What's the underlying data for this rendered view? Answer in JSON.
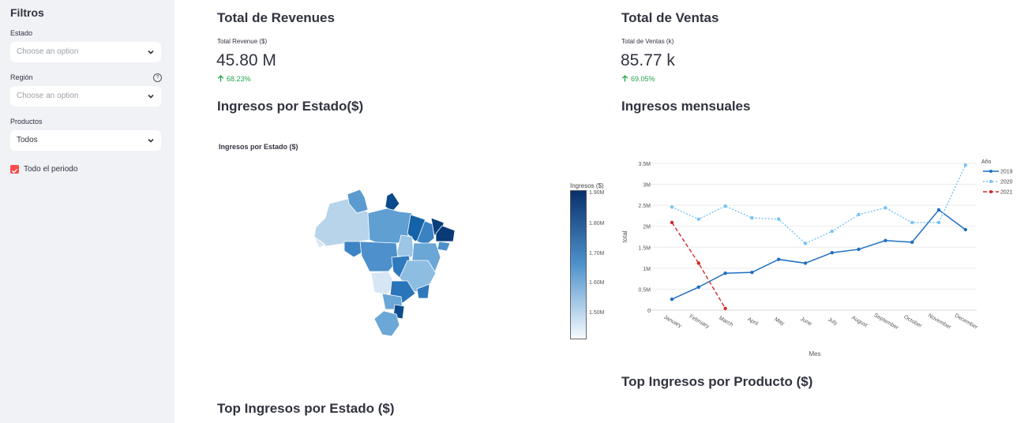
{
  "sidebar": {
    "title": "Filtros",
    "estado": {
      "label": "Estado",
      "placeholder": "Choose an option"
    },
    "region": {
      "label": "Región",
      "placeholder": "Choose an option",
      "help": "?"
    },
    "productos": {
      "label": "Productos",
      "value": "Todos"
    },
    "periodo": {
      "label": "Todo el periodo",
      "checked": true
    }
  },
  "revenues": {
    "heading": "Total de Revenues",
    "metric_label": "Total Revenue ($)",
    "metric_value": "45.80 M",
    "delta": "68.23%"
  },
  "ventas": {
    "heading": "Total de Ventas",
    "metric_label": "Total de Ventas (k)",
    "metric_value": "85.77 k",
    "delta": "69.05%"
  },
  "map_section": {
    "heading": "Ingresos por Estado($)",
    "chart_title": "Ingresos por Estado ($)",
    "colorbar_title": "Ingresos ($)",
    "colorbar_ticks": [
      "1.90M",
      "1.80M",
      "1.70M",
      "1.60M",
      "1.50M"
    ]
  },
  "line_section": {
    "heading": "Ingresos mensuales"
  },
  "top_producto": {
    "heading": "Top Ingresos por Producto ($)"
  },
  "top_estado": {
    "heading": "Top Ingresos por Estado ($)"
  },
  "colors": {
    "accent": "#ff4b4b",
    "delta": "#21a348",
    "s2019": "#1f6fc2",
    "s2020": "#79c3f2",
    "s2021": "#d62728"
  },
  "chart_data": {
    "type": "line",
    "xlabel": "Mes",
    "ylabel": "total",
    "legend_title": "Año",
    "legend_position": "top-right",
    "ylim": [
      0,
      3500000
    ],
    "yticks": [
      0,
      500000,
      1000000,
      1500000,
      2000000,
      2500000,
      3000000,
      3500000
    ],
    "ytick_labels": [
      "0",
      "0.5M",
      "1M",
      "1.5M",
      "2M",
      "2.5M",
      "3M",
      "3.5M"
    ],
    "categories": [
      "January",
      "February",
      "March",
      "April",
      "May",
      "June",
      "July",
      "August",
      "September",
      "October",
      "November",
      "December"
    ],
    "series": [
      {
        "name": "2019",
        "values": [
          260000,
          550000,
          880000,
          900000,
          1210000,
          1120000,
          1370000,
          1450000,
          1660000,
          1620000,
          2390000,
          1920000
        ],
        "color": "#1f6fc2",
        "dash": "solid"
      },
      {
        "name": "2020",
        "values": [
          2460000,
          2170000,
          2480000,
          2200000,
          2170000,
          1590000,
          1880000,
          2280000,
          2440000,
          2090000,
          2090000,
          3460000
        ],
        "color": "#79c3f2",
        "dash": "dot"
      },
      {
        "name": "2021",
        "values": [
          2090000,
          1120000,
          40000
        ],
        "color": "#d62728",
        "dash": "dash"
      }
    ]
  }
}
